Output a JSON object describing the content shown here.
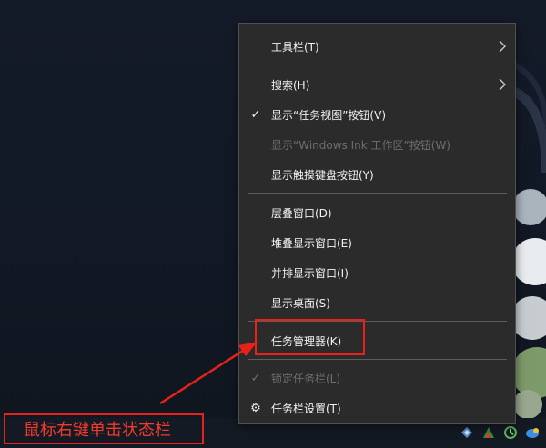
{
  "context_menu": {
    "items": [
      {
        "label": "工具栏(T)",
        "checked": false,
        "disabled": false,
        "submenu": true,
        "icon": ""
      },
      {
        "label": "搜索(H)",
        "checked": false,
        "disabled": false,
        "submenu": true,
        "icon": ""
      },
      {
        "label": "显示“任务视图”按钮(V)",
        "checked": true,
        "disabled": false,
        "submenu": false,
        "icon": ""
      },
      {
        "label": "显示“Windows Ink 工作区”按钮(W)",
        "checked": false,
        "disabled": true,
        "submenu": false,
        "icon": ""
      },
      {
        "label": "显示触摸键盘按钮(Y)",
        "checked": false,
        "disabled": false,
        "submenu": false,
        "icon": ""
      },
      {
        "label": "层叠窗口(D)",
        "checked": false,
        "disabled": false,
        "submenu": false,
        "icon": ""
      },
      {
        "label": "堆叠显示窗口(E)",
        "checked": false,
        "disabled": false,
        "submenu": false,
        "icon": ""
      },
      {
        "label": "并排显示窗口(I)",
        "checked": false,
        "disabled": false,
        "submenu": false,
        "icon": ""
      },
      {
        "label": "显示桌面(S)",
        "checked": false,
        "disabled": false,
        "submenu": false,
        "icon": ""
      },
      {
        "label": "任务管理器(K)",
        "checked": false,
        "disabled": false,
        "submenu": false,
        "icon": ""
      },
      {
        "label": "锁定任务栏(L)",
        "checked": true,
        "disabled": true,
        "submenu": false,
        "icon": ""
      },
      {
        "label": "任务栏设置(T)",
        "checked": false,
        "disabled": false,
        "submenu": false,
        "icon": "gear-icon"
      }
    ],
    "check_glyph": "✓",
    "gear_glyph": "⚙"
  },
  "annotation": {
    "text": "鼠标右键单击状态栏"
  },
  "colors": {
    "menu_bg": "#2b2b2b",
    "menu_text": "#f2f2f2",
    "disabled_text": "#6e6e6e",
    "annotation_red": "#e8221b",
    "desktop_bg": "#121926"
  },
  "tray_icons": [
    "network-icon",
    "app-icon",
    "sync-icon",
    "cloud-icon"
  ]
}
